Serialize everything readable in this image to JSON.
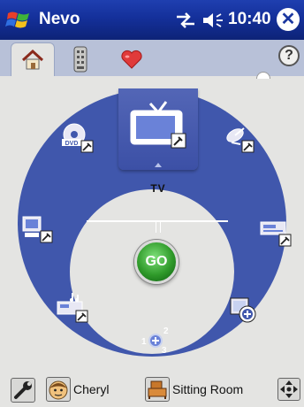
{
  "title_bar": {
    "app_title": "Nevo",
    "clock": "10:40",
    "close_label": "✕",
    "start_icon": "windows-flag-icon",
    "connection_icon": "connectivity-icon",
    "volume_icon": "speaker-icon"
  },
  "tabs": [
    {
      "name": "home",
      "icon": "home-icon",
      "selected": true
    },
    {
      "name": "remote",
      "icon": "remote-icon",
      "selected": false
    },
    {
      "name": "favorites",
      "icon": "heart-icon",
      "selected": false
    }
  ],
  "help_label": "?",
  "wheel": {
    "selected_device": "TV",
    "go_label": "GO",
    "devices": [
      {
        "name": "tv",
        "icon": "tv-icon",
        "selected": true
      },
      {
        "name": "satellite",
        "icon": "satellite-dish-icon"
      },
      {
        "name": "vcr",
        "icon": "vcr-icon"
      },
      {
        "name": "add-device",
        "icon": "add-device-icon"
      },
      {
        "name": "channel-123",
        "icon": "numbers-icon",
        "label_digits": [
          "1",
          "2",
          "3"
        ]
      },
      {
        "name": "audio",
        "icon": "audio-receiver-icon"
      },
      {
        "name": "pc",
        "icon": "computer-icon"
      },
      {
        "name": "dvd",
        "icon": "dvd-icon",
        "label": "DVD"
      }
    ],
    "colors": {
      "ring": "#4057ac",
      "center": "#e4e4e2",
      "go": "#2f9a2a"
    }
  },
  "bottom_bar": {
    "settings_icon": "wrench-icon",
    "user_name": "Cheryl",
    "room_name": "Sitting Room",
    "nav_icon": "four-way-arrow-icon"
  }
}
